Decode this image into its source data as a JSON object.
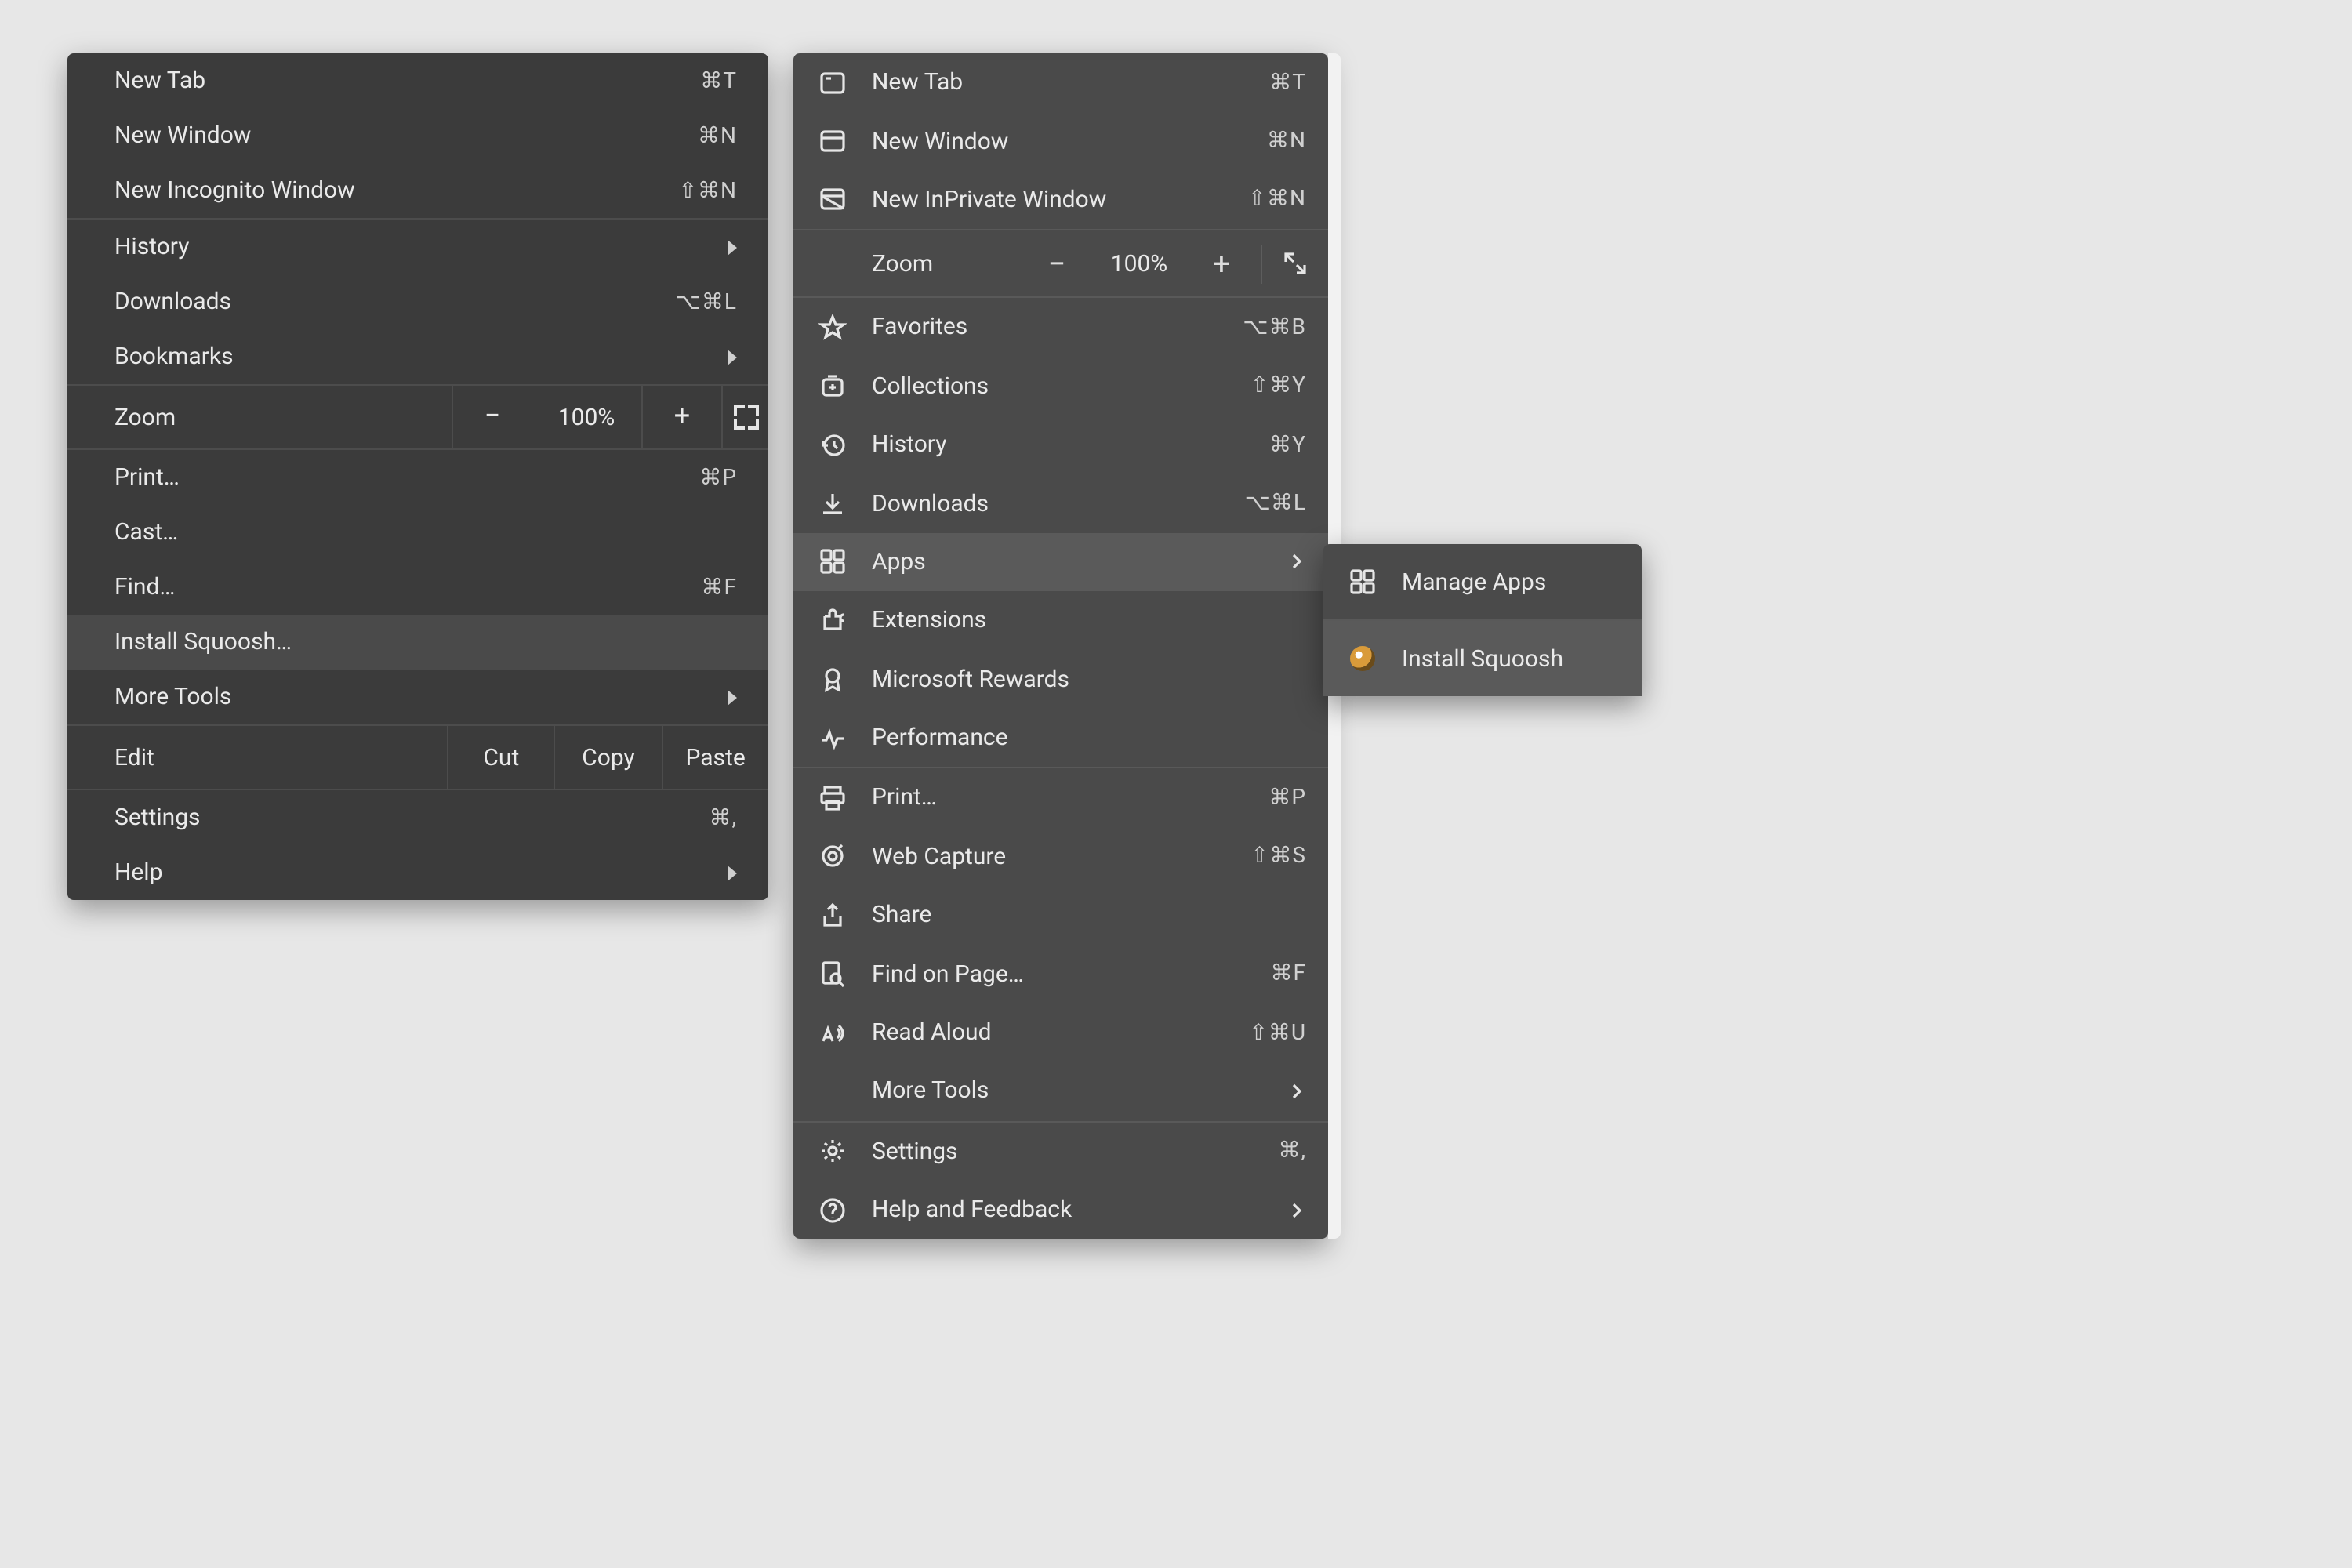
{
  "chrome": {
    "new_tab": "New Tab",
    "new_tab_sc": "⌘T",
    "new_window": "New Window",
    "new_window_sc": "⌘N",
    "new_incognito": "New Incognito Window",
    "new_incognito_sc": "⇧⌘N",
    "history": "History",
    "downloads": "Downloads",
    "downloads_sc": "⌥⌘L",
    "bookmarks": "Bookmarks",
    "zoom": "Zoom",
    "zoom_value": "100%",
    "zoom_out": "−",
    "zoom_in": "+",
    "print": "Print…",
    "print_sc": "⌘P",
    "cast": "Cast…",
    "find": "Find…",
    "find_sc": "⌘F",
    "install": "Install Squoosh…",
    "more_tools": "More Tools",
    "edit": "Edit",
    "cut": "Cut",
    "copy": "Copy",
    "paste": "Paste",
    "settings": "Settings",
    "settings_sc": "⌘,",
    "help": "Help"
  },
  "edge": {
    "new_tab": "New Tab",
    "new_tab_sc": "⌘T",
    "new_window": "New Window",
    "new_window_sc": "⌘N",
    "new_inprivate": "New InPrivate Window",
    "new_inprivate_sc": "⇧⌘N",
    "zoom": "Zoom",
    "zoom_value": "100%",
    "zoom_out": "−",
    "zoom_in": "+",
    "favorites": "Favorites",
    "favorites_sc": "⌥⌘B",
    "collections": "Collections",
    "collections_sc": "⇧⌘Y",
    "history": "History",
    "history_sc": "⌘Y",
    "downloads": "Downloads",
    "downloads_sc": "⌥⌘L",
    "apps": "Apps",
    "extensions": "Extensions",
    "rewards": "Microsoft Rewards",
    "performance": "Performance",
    "print": "Print…",
    "print_sc": "⌘P",
    "web_capture": "Web Capture",
    "web_capture_sc": "⇧⌘S",
    "share": "Share",
    "find": "Find on Page…",
    "find_sc": "⌘F",
    "read_aloud": "Read Aloud",
    "read_aloud_sc": "⇧⌘U",
    "more_tools": "More Tools",
    "settings": "Settings",
    "settings_sc": "⌘,",
    "help": "Help and Feedback"
  },
  "submenu": {
    "manage": "Manage Apps",
    "install": "Install Squoosh"
  }
}
